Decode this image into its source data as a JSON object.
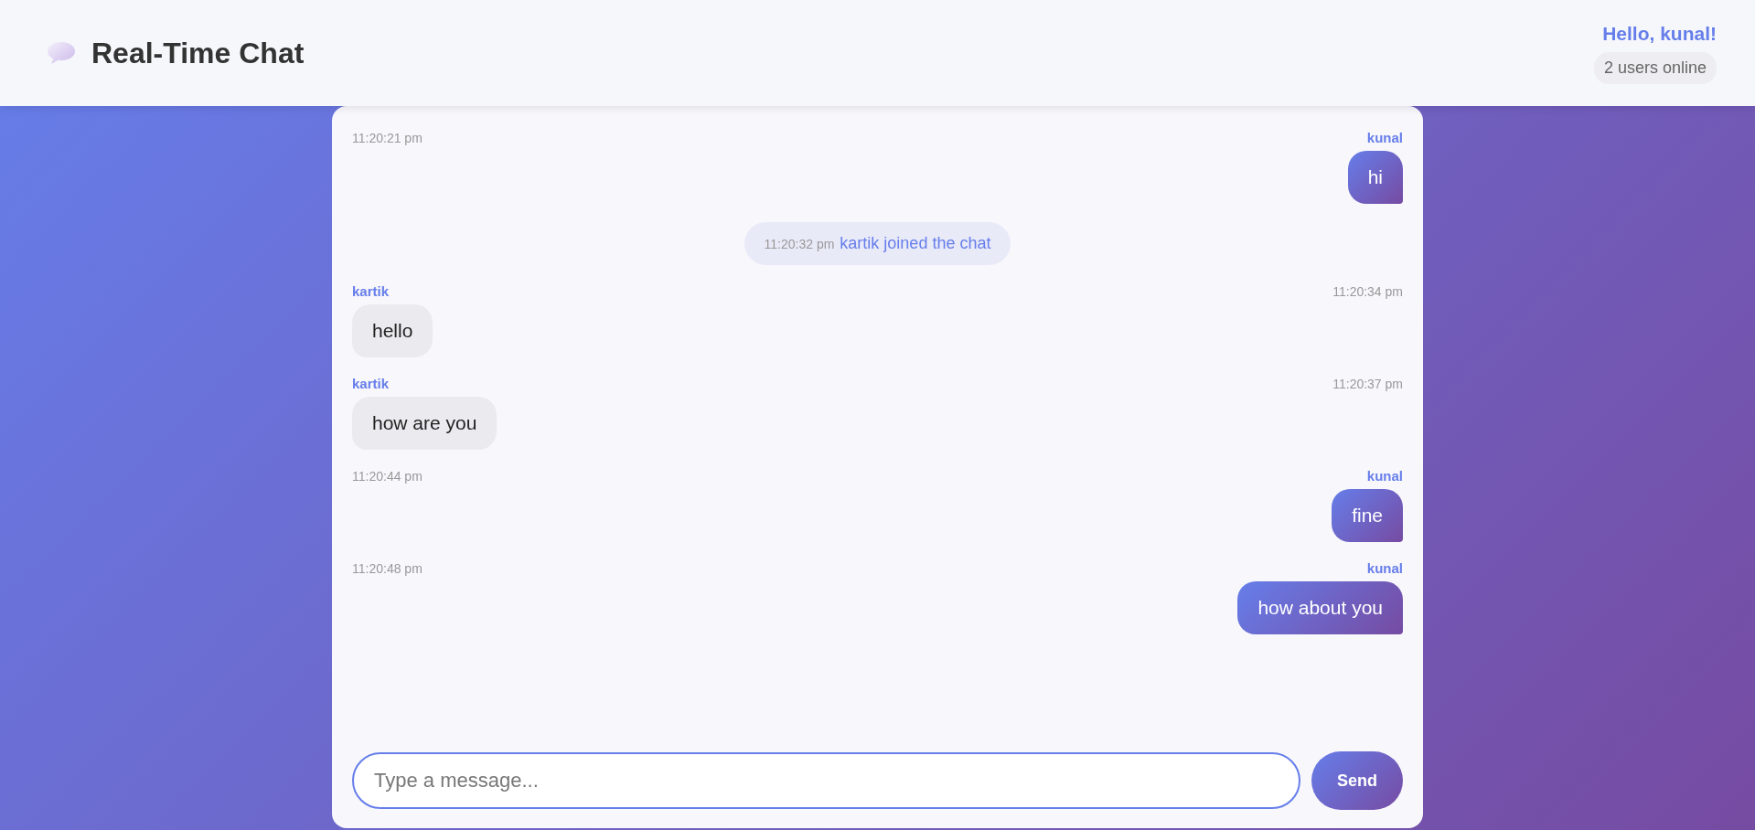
{
  "header": {
    "title": "Real-Time Chat",
    "greeting": "Hello, kunal!",
    "online": "2 users online"
  },
  "messages": [
    {
      "kind": "own",
      "user": "kunal",
      "time": "11:20:21 pm",
      "text": "hi"
    },
    {
      "kind": "system",
      "time": "11:20:32 pm",
      "text": "kartik joined the chat"
    },
    {
      "kind": "other",
      "user": "kartik",
      "time": "11:20:34 pm",
      "text": "hello"
    },
    {
      "kind": "other",
      "user": "kartik",
      "time": "11:20:37 pm",
      "text": "how are you"
    },
    {
      "kind": "own",
      "user": "kunal",
      "time": "11:20:44 pm",
      "text": "fine"
    },
    {
      "kind": "own",
      "user": "kunal",
      "time": "11:20:48 pm",
      "text": "how about you"
    }
  ],
  "composer": {
    "placeholder": "Type a message...",
    "button": "Send"
  }
}
